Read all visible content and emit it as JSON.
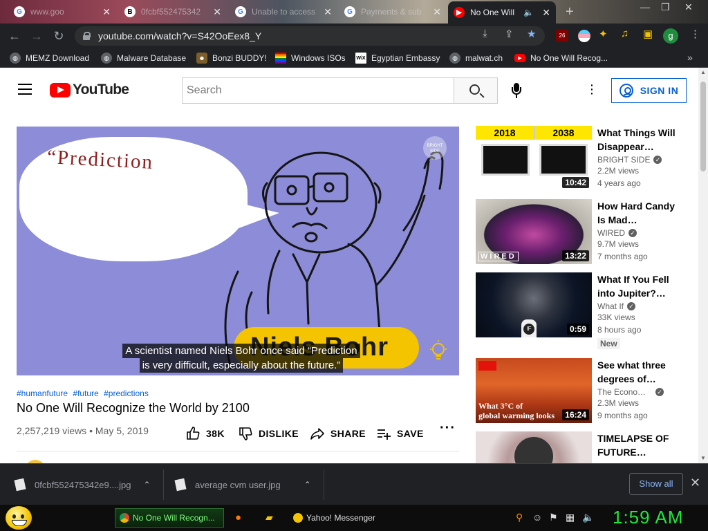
{
  "browser": {
    "tabs": [
      {
        "title": "www.goo",
        "favicon": "google-icon",
        "active": false
      },
      {
        "title": "0fcbf552475342",
        "favicon": "b-icon",
        "active": false
      },
      {
        "title": "Unable to access",
        "favicon": "google-icon",
        "active": false
      },
      {
        "title": "Payments & sub",
        "favicon": "google-icon",
        "active": false
      },
      {
        "title": "No One Will",
        "favicon": "youtube-icon",
        "active": true
      }
    ],
    "url": "youtube.com/watch?v=S42OoEex8_Y",
    "extension_badge": "26",
    "profile_initial": "g",
    "bookmarks": [
      {
        "label": "MEMZ Download",
        "icon": "globe-icon"
      },
      {
        "label": "Malware Database",
        "icon": "globe-icon"
      },
      {
        "label": "Bonzi BUDDY!",
        "icon": "monkey-icon"
      },
      {
        "label": "Windows ISOs",
        "icon": "rainbow-flag-icon"
      },
      {
        "label": "Egyptian Embassy",
        "icon": "wix-icon"
      },
      {
        "label": "malwat.ch",
        "icon": "globe-icon"
      },
      {
        "label": "No One Will Recog...",
        "icon": "youtube-icon"
      }
    ],
    "bookmarks_more": "»"
  },
  "youtube": {
    "logo_text": "YouTube",
    "search_placeholder": "Search",
    "sign_in_label": "SIGN IN",
    "player": {
      "bubble_text": "“Prediction",
      "name_plate": "Niels Bohr",
      "caption_line1": "A scientist named Niels Bohr once said “Prediction",
      "caption_line2": "is very difficult, especially about the future.”",
      "watermark": "BRIGHT SIDE"
    },
    "video": {
      "hashtags": [
        "#humanfuture",
        "#future",
        "#predictions"
      ],
      "title": "No One Will Recognize the World by 2100",
      "views": "2,257,219 views",
      "date": "May 5, 2019",
      "likes": "38K",
      "dislike_label": "DISLIKE",
      "share_label": "SHARE",
      "save_label": "SAVE"
    },
    "recommendations": [
      {
        "title": "What Things Will Disappear…",
        "channel": "BRIGHT SIDE",
        "verified": true,
        "views": "2.2M views",
        "age": "4 years ago",
        "duration": "10:42",
        "thumb_labels": [
          "2018",
          "2038"
        ],
        "badge": ""
      },
      {
        "title": "How Hard Candy Is Mad…",
        "channel": "WIRED",
        "verified": true,
        "views": "9.7M views",
        "age": "7 months ago",
        "duration": "13:22",
        "thumb_labels": [
          "WIRED"
        ],
        "badge": ""
      },
      {
        "title": "What If You Fell into Jupiter?…",
        "channel": "What If",
        "verified": true,
        "views": "33K views",
        "age": "8 hours ago",
        "duration": "0:59",
        "thumb_labels": [
          "IF"
        ],
        "badge": "New"
      },
      {
        "title": "See what three degrees of…",
        "channel": "The Econo…",
        "verified": true,
        "views": "2.3M views",
        "age": "9 months ago",
        "duration": "16:24",
        "thumb_labels": [
          "What 3°C of",
          "global warming looks"
        ],
        "badge": ""
      },
      {
        "title": "TIMELAPSE OF FUTURE…",
        "channel": "",
        "verified": false,
        "views": "",
        "age": "",
        "duration": "",
        "thumb_labels": [],
        "badge": ""
      }
    ]
  },
  "downloads": {
    "items": [
      "0fcbf552475342e9....jpg",
      "average cvm user.jpg"
    ],
    "show_all": "Show all"
  },
  "taskbar": {
    "tasks": [
      "No One Will Recogn...",
      "Yahoo! Messenger"
    ],
    "clock": "1:59 AM"
  },
  "colors": {
    "yt_red": "#ff0000",
    "link_blue": "#065fd4",
    "clock_green": "#1ee63c",
    "chrome_dark": "#202124"
  }
}
